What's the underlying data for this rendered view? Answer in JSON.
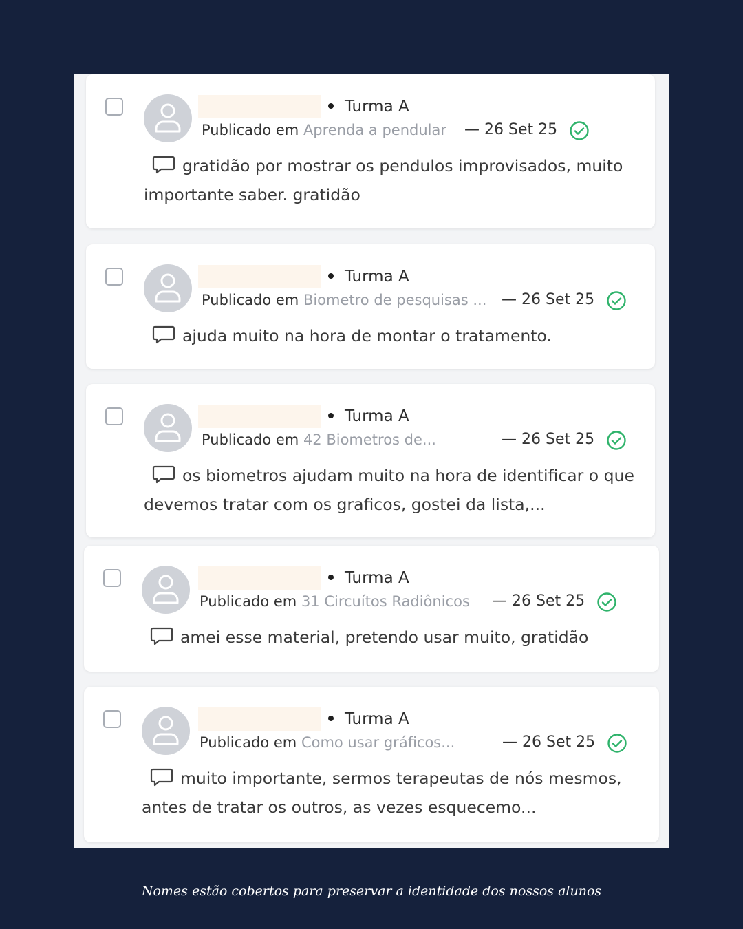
{
  "posts": [
    {
      "class_label": "Turma A",
      "published_prefix": "Publicado em",
      "course": "Aprenda a pendular",
      "date": "— 26 Set 25",
      "comment": "gratidão por mostrar os pendulos improvisados, muito importante saber. gratidão"
    },
    {
      "class_label": "Turma A",
      "published_prefix": "Publicado em",
      "course": "Biometro de pesquisas ...",
      "date": "— 26 Set 25",
      "comment": "ajuda muito na hora de montar o tratamento."
    },
    {
      "class_label": "Turma A",
      "published_prefix": "Publicado em",
      "course": "42 Biometros de...",
      "date": "— 26 Set 25",
      "comment": "os biometros ajudam muito na hora de identificar o que devemos tratar com os graficos, gostei da lista,..."
    },
    {
      "class_label": "Turma A",
      "published_prefix": "Publicado em",
      "course": "31 Circuítos Radiônicos",
      "date": "— 26 Set 25",
      "comment": "amei esse material, pretendo usar muito, gratidão"
    },
    {
      "class_label": "Turma A",
      "published_prefix": "Publicado em",
      "course": "Como usar gráficos...",
      "date": "— 26 Set 25",
      "comment": "muito importante, sermos terapeutas de nós mesmos, antes de tratar os outros, as vezes esquecemo..."
    }
  ],
  "caption": "Nomes estão cobertos para preservar a identidade dos nossos alunos",
  "colors": {
    "background": "#15213c",
    "approved_check": "#2fb36b",
    "course_link": "#9a9ea6",
    "name_mask": "#fdf5ec"
  },
  "icons": {
    "avatar": "user-placeholder-icon",
    "status": "check-circle-icon",
    "comment": "speech-bubble-icon"
  }
}
